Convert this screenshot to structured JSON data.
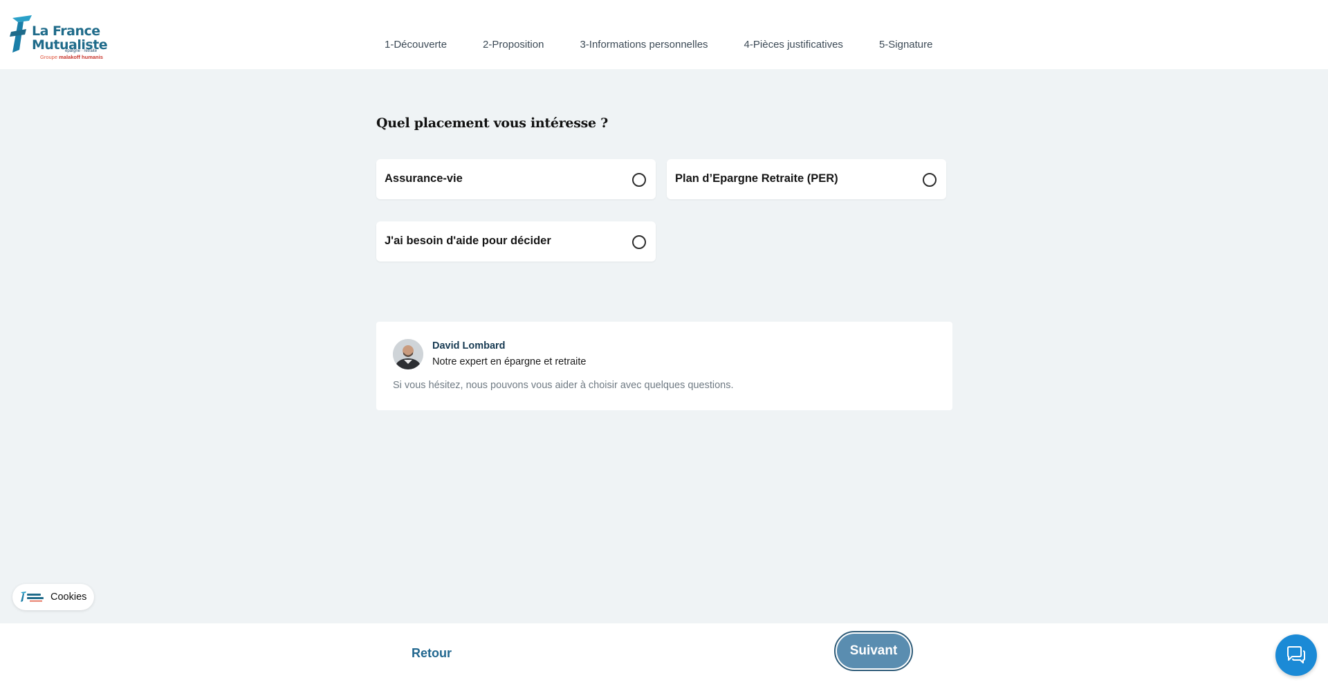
{
  "header": {
    "logo": {
      "title_line1": "La France",
      "title_line2": "Mutualiste",
      "subtitle": "épargne · retraite",
      "group_prefix": "Groupe",
      "group_name": "malakoff humanis",
      "icon": "lfm-flag-logo"
    },
    "steps": [
      {
        "label": "1-Découverte"
      },
      {
        "label": "2-Proposition"
      },
      {
        "label": "3-Informations personnelles"
      },
      {
        "label": "4-Pièces justificatives"
      },
      {
        "label": "5-Signature"
      }
    ]
  },
  "main": {
    "question": "Quel placement vous intéresse ?",
    "options": [
      {
        "label": "Assurance-vie",
        "selected": false
      },
      {
        "label": "Plan d’Epargne Retraite (PER)",
        "selected": false
      },
      {
        "label": "J'ai besoin d'aide pour décider",
        "selected": false
      }
    ],
    "expert": {
      "name": "David Lombard",
      "role": "Notre expert en épargne et retraite",
      "message": "Si vous hésitez, nous pouvons vous aider à choisir avec quelques questions."
    }
  },
  "cookies": {
    "label": "Cookies"
  },
  "footer": {
    "back_label": "Retour",
    "next_label": "Suivant"
  },
  "chat": {
    "icon": "chat-bubbles-icon"
  },
  "colors": {
    "brand_teal": "#1f6b8a",
    "accent_red": "#e0553d",
    "page_bg": "#eff3f5",
    "next_button": "#5a8db0",
    "link": "#21678f",
    "chat": "#1b8ad6"
  }
}
